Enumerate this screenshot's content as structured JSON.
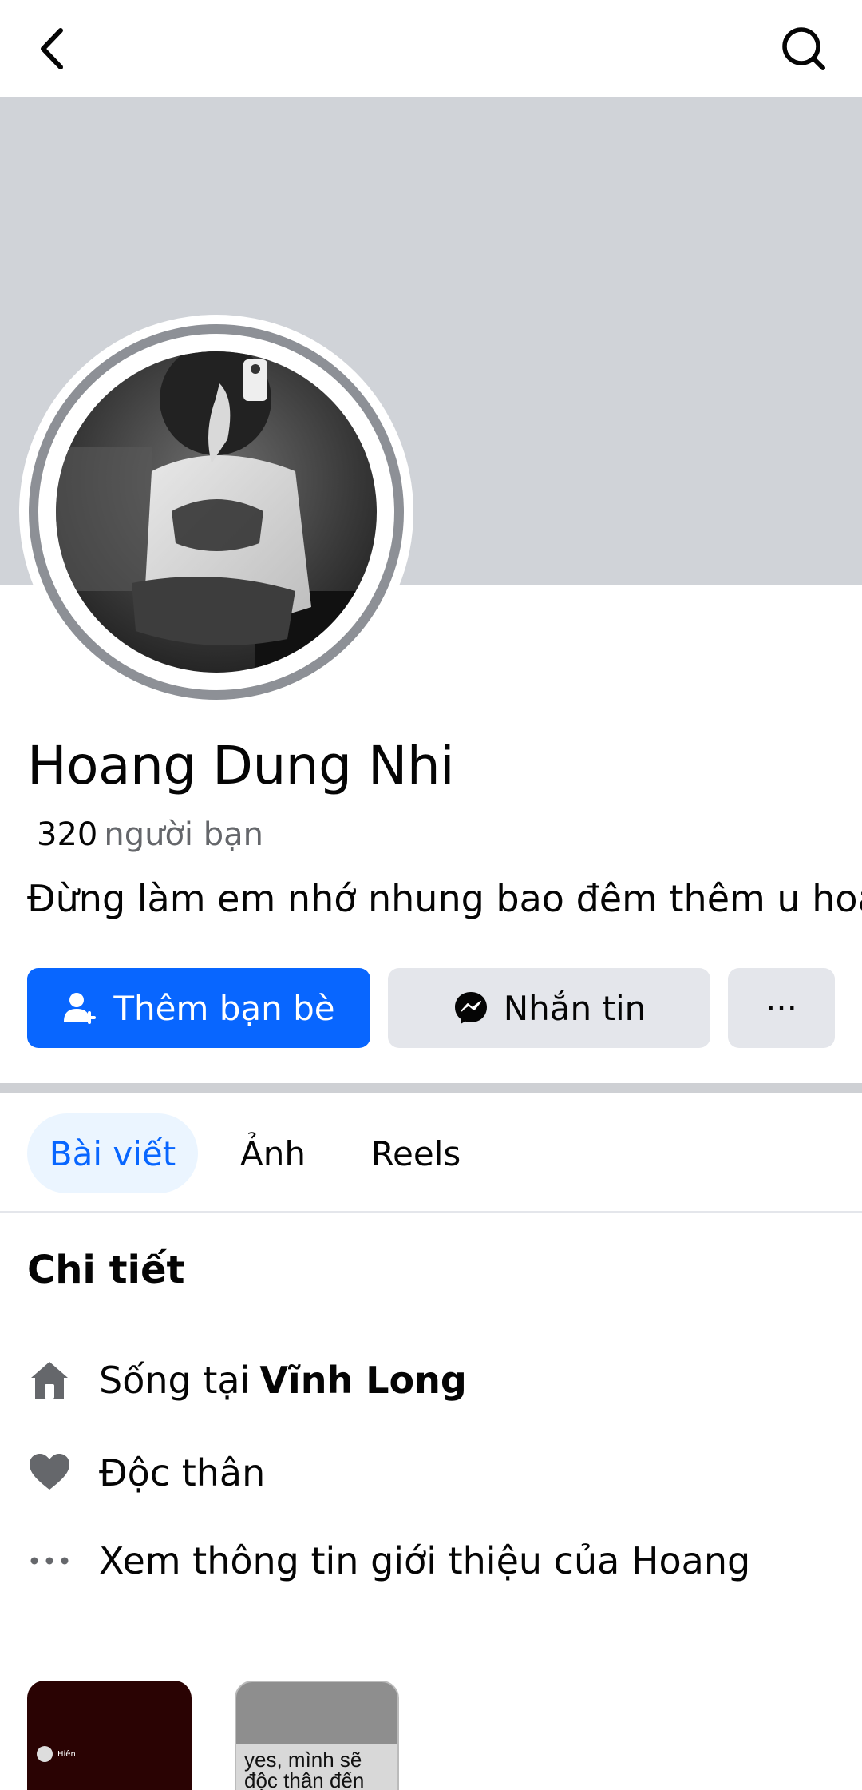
{
  "profile": {
    "name": "Hoang Dung Nhi",
    "friends_count": "320",
    "friends_label": "người bạn",
    "bio": "Đừng làm em nhớ nhung bao đêm thêm u hoài"
  },
  "actions": {
    "add_friend": "Thêm bạn bè",
    "message": "Nhắn tin",
    "more": "···"
  },
  "tabs": [
    {
      "label": "Bài viết",
      "active": true
    },
    {
      "label": "Ảnh",
      "active": false
    },
    {
      "label": "Reels",
      "active": false
    }
  ],
  "details": {
    "title": "Chi tiết",
    "lives_prefix": "Sống tại",
    "lives_place": "Vĩnh Long",
    "relationship": "Độc thân",
    "see_more": "Xem thông tin giới thiệu của Hoang"
  },
  "thumbnails": [
    {
      "caption": "Hiên"
    },
    {
      "caption": "yes, mình sẽ độc thân đến khi gặp"
    }
  ],
  "colors": {
    "primary": "#0866ff",
    "cover": "#d0d3d8",
    "secondary_button": "#e4e6eb",
    "tab_active_bg": "#ebf5ff"
  },
  "icons": {
    "back": "chevron-left-icon",
    "search": "search-icon",
    "add_friend": "person-plus-icon",
    "messenger": "messenger-icon",
    "home": "home-icon",
    "heart": "heart-icon",
    "more": "more-dots-icon"
  }
}
